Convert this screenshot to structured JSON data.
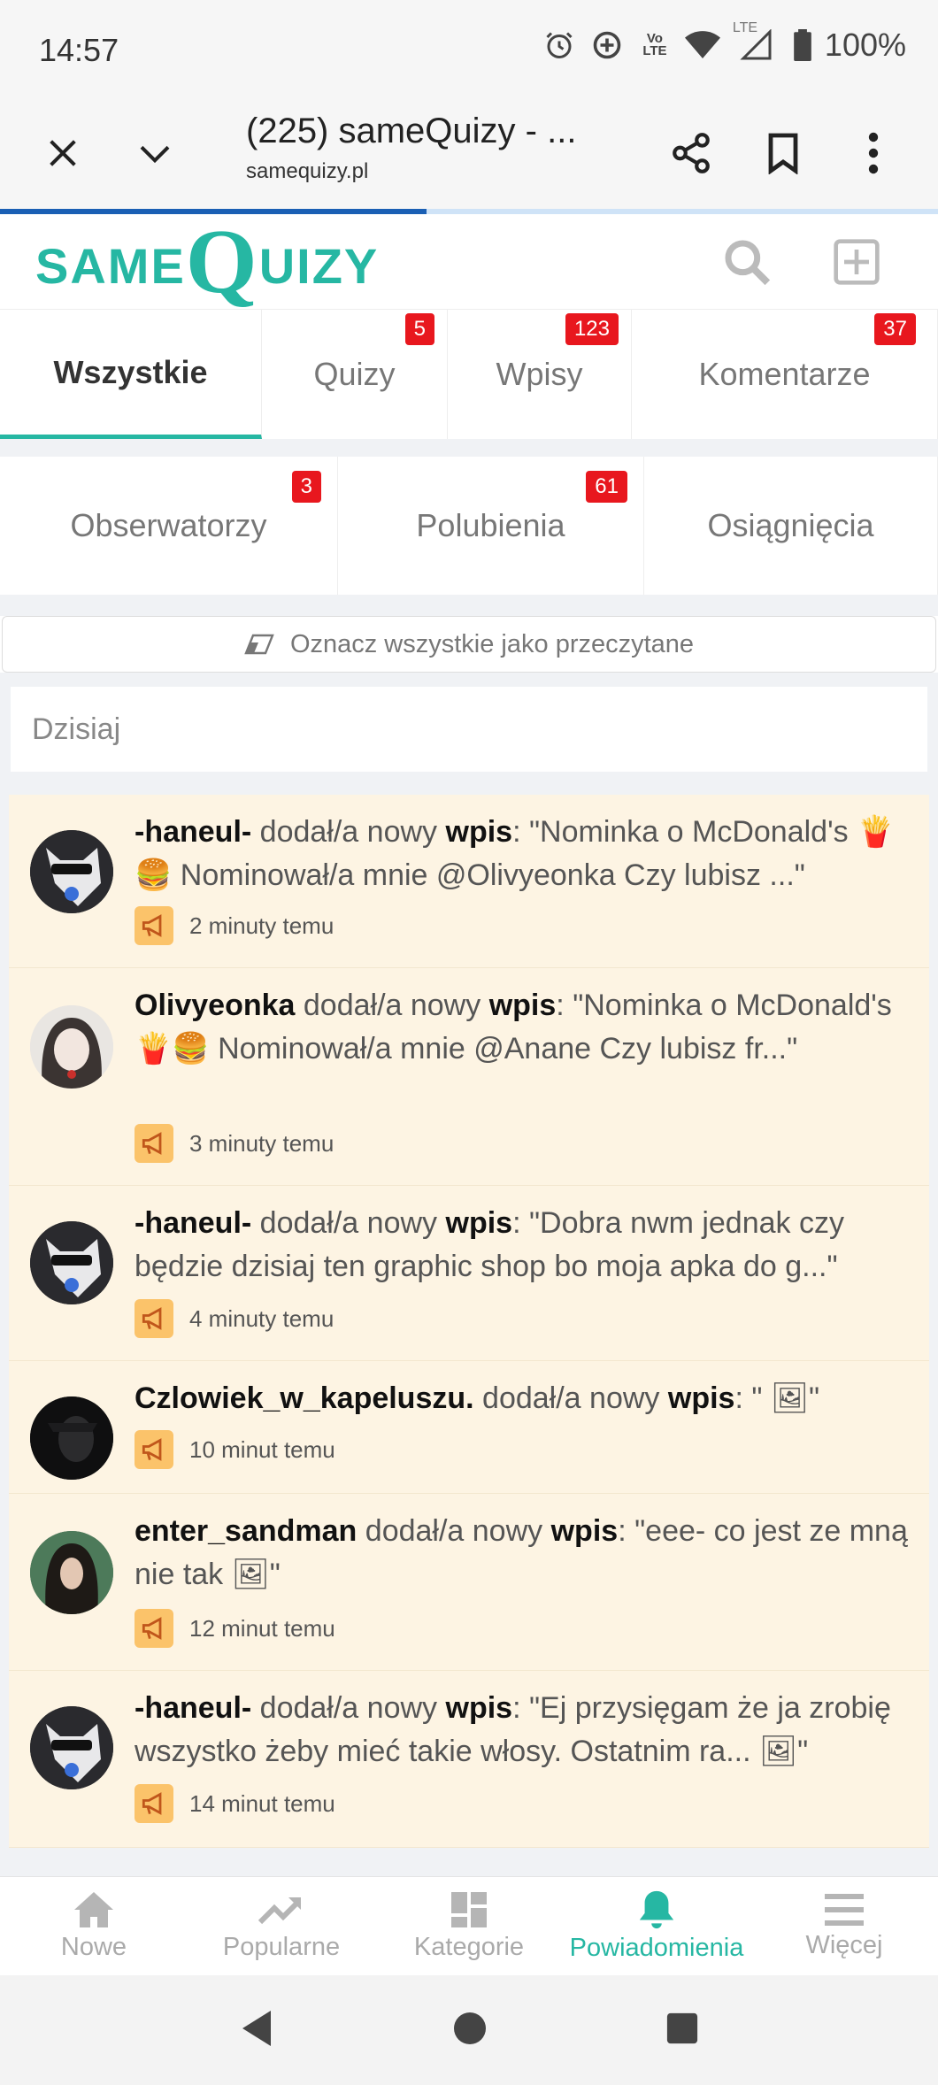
{
  "status_bar": {
    "time": "14:57",
    "battery": "100%",
    "icons": [
      "alarm-icon",
      "data-saver-icon",
      "volte-icon",
      "wifi-icon",
      "lte-signal-icon",
      "battery-icon"
    ],
    "volte_label": "Vo\nLTE",
    "lte_label": "LTE"
  },
  "browser": {
    "title": "(225) sameQuizy - ...",
    "url": "samequizy.pl",
    "load_progress": 0.455
  },
  "site": {
    "logo_same": "SAME",
    "logo_q": "Q",
    "logo_uizy": "UIZY",
    "accent": "#26b7a3"
  },
  "tabs_row1": [
    {
      "label": "Wszystkie",
      "badge": ""
    },
    {
      "label": "Quizy",
      "badge": "5"
    },
    {
      "label": "Wpisy",
      "badge": "123"
    },
    {
      "label": "Komentarze",
      "badge": "37"
    }
  ],
  "tabs_row2": [
    {
      "label": "Obserwatorzy",
      "badge": "3"
    },
    {
      "label": "Polubienia",
      "badge": "61"
    },
    {
      "label": "Osiągnięcia",
      "badge": ""
    }
  ],
  "mark_all_label": "Oznacz wszystkie jako przeczytane",
  "day_header": "Dzisiaj",
  "action_text": "dodał/a nowy",
  "action_obj": "wpis",
  "notifications": [
    {
      "user": "-haneul-",
      "text": "\"Nominka o McDonald's 🍟🍔 Nominował/a mnie @Olivyeonka Czy lubisz ...\"",
      "time": "2 minuty temu"
    },
    {
      "user": "Olivyeonka",
      "text": "\"Nominka o McDonald's 🍟🍔 Nominował/a mnie @Anane Czy lubisz fr...\"",
      "time": "3 minuty temu"
    },
    {
      "user": "-haneul-",
      "text": "\"Dobra nwm jednak czy będzie dzisiaj ten graphic shop bo moja apka do g...\"",
      "time": "4 minuty temu"
    },
    {
      "user": "Czlowiek_w_kapeluszu.",
      "text": "\" 🖼\"",
      "time": "10 minut temu"
    },
    {
      "user": "enter_sandman",
      "text": "\"eee- co jest ze mną nie tak 🖼\"",
      "time": "12 minut temu"
    },
    {
      "user": "-haneul-",
      "text": "\"Ej przysięgam że ja zrobię wszystko żeby mieć takie włosy. Ostatnim ra... 🖼\"",
      "time": "14 minut temu"
    }
  ],
  "bottom_nav": [
    {
      "label": "Nowe",
      "icon": "home-icon"
    },
    {
      "label": "Popularne",
      "icon": "trending-icon"
    },
    {
      "label": "Kategorie",
      "icon": "categories-icon"
    },
    {
      "label": "Powiadomienia",
      "icon": "bell-icon"
    },
    {
      "label": "Więcej",
      "icon": "menu-icon"
    }
  ]
}
